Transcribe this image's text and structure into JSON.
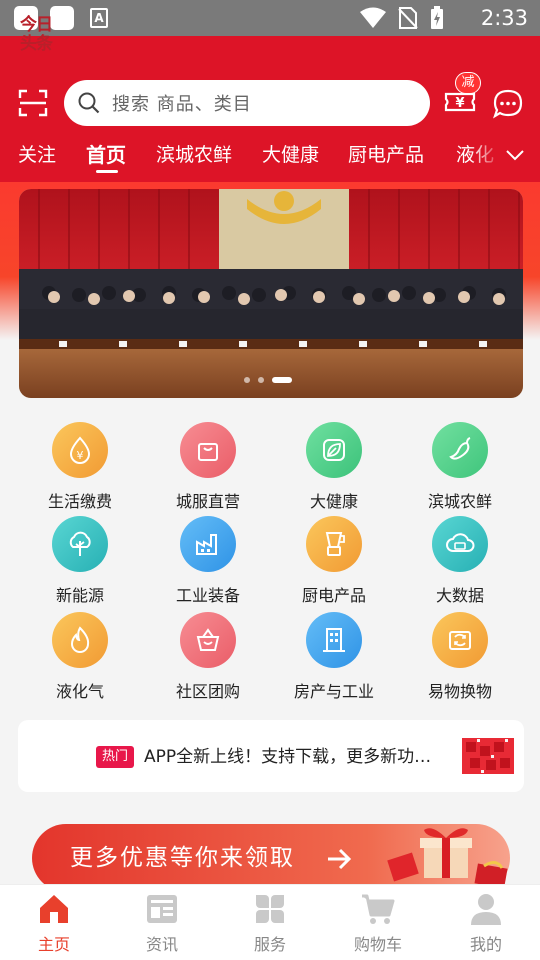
{
  "status_bar": {
    "time": "2:33",
    "notification_glyph": "A"
  },
  "header": {
    "search_placeholder": "搜索 商品、类目",
    "coupon_badge": "减",
    "tabs": [
      {
        "label": "关注"
      },
      {
        "label": "首页"
      },
      {
        "label": "滨城农鲜"
      },
      {
        "label": "大健康"
      },
      {
        "label": "厨电产品"
      },
      {
        "label": "液化"
      }
    ],
    "active_tab": "首页"
  },
  "banner": {
    "slide_count": 3,
    "active_slide": 3
  },
  "categories": [
    {
      "label": "生活缴费",
      "icon": "yen-drop-icon",
      "color": "#f6a93b"
    },
    {
      "label": "城服直营",
      "icon": "shopping-bag-icon",
      "color": "#f06a72"
    },
    {
      "label": "大健康",
      "icon": "leaf-icon",
      "color": "#4fcf85"
    },
    {
      "label": "滨城农鲜",
      "icon": "pepper-icon",
      "color": "#55d089"
    },
    {
      "label": "新能源",
      "icon": "tree-icon",
      "color": "#35c4c4"
    },
    {
      "label": "工业装备",
      "icon": "factory-icon",
      "color": "#3ba7f2"
    },
    {
      "label": "厨电产品",
      "icon": "blender-icon",
      "color": "#f6a93b"
    },
    {
      "label": "大数据",
      "icon": "cloud-data-icon",
      "color": "#35c4c4"
    },
    {
      "label": "液化气",
      "icon": "flame-icon",
      "color": "#f6a93b"
    },
    {
      "label": "社区团购",
      "icon": "basket-icon",
      "color": "#f06a72"
    },
    {
      "label": "房产与工业",
      "icon": "building-icon",
      "color": "#3ba7f2"
    },
    {
      "label": "易物换物",
      "icon": "exchange-icon",
      "color": "#f6a93b"
    }
  ],
  "news": {
    "logo_line1": "今日",
    "logo_line2": "头条",
    "tag": "热门",
    "headline": "APP全新上线！支持下载，更多新功能等你来体验"
  },
  "promo": {
    "label": "更多优惠等你来领取"
  },
  "bottom_nav": [
    {
      "label": "主页",
      "icon": "home-icon"
    },
    {
      "label": "资讯",
      "icon": "news-icon"
    },
    {
      "label": "服务",
      "icon": "service-icon"
    },
    {
      "label": "购物车",
      "icon": "cart-icon"
    },
    {
      "label": "我的",
      "icon": "profile-icon"
    }
  ],
  "active_nav": "主页",
  "colors": {
    "brand_red": "#dd1427",
    "active_nav": "#e8402c",
    "hot_tag": "#e8174a"
  }
}
